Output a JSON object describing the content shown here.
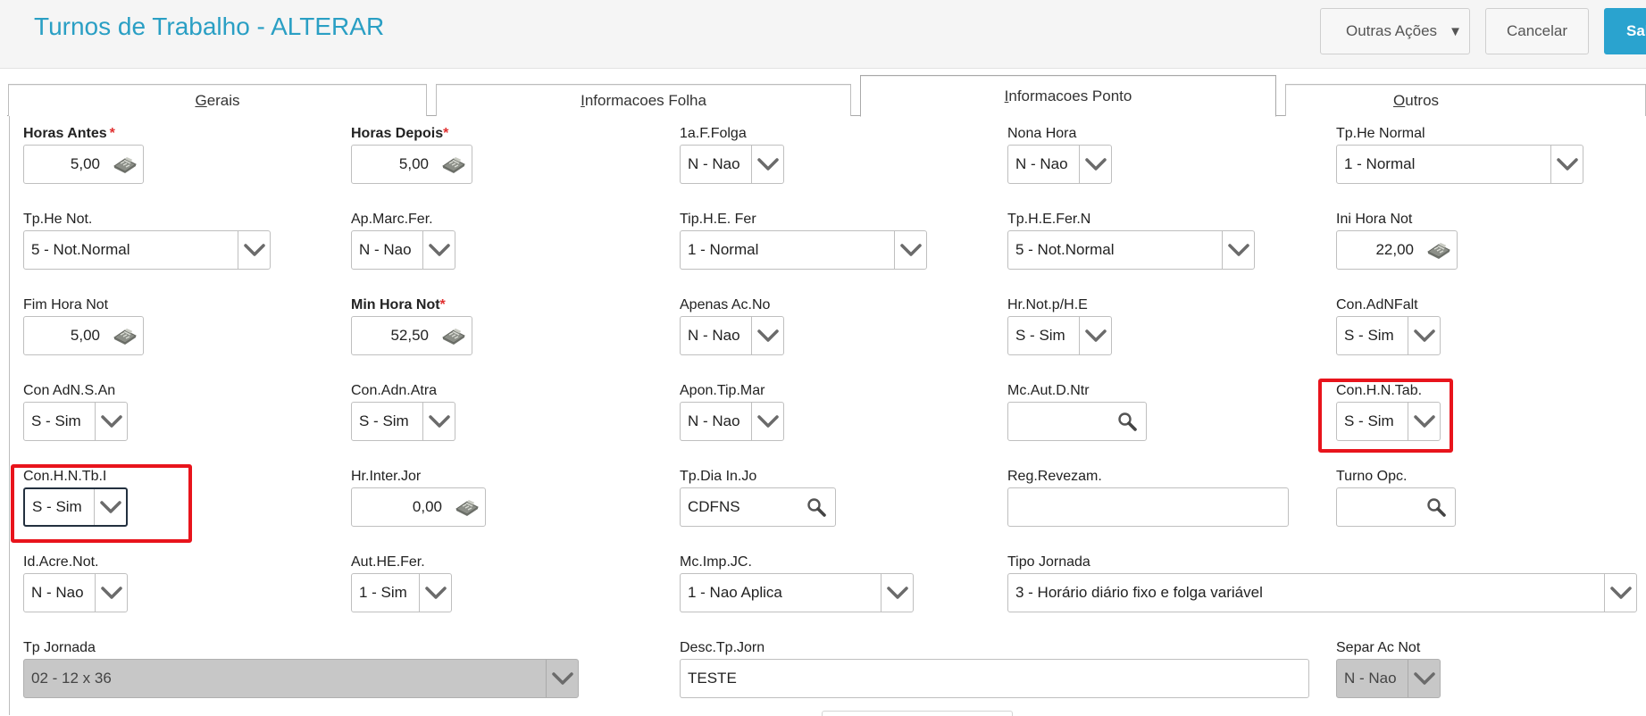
{
  "header": {
    "title": "Turnos de Trabalho - ALTERAR",
    "more_actions": "Outras Ações",
    "cancel": "Cancelar",
    "save": "Sal"
  },
  "tabs": [
    {
      "label": "Gerais",
      "accel": "G",
      "rest": "erais"
    },
    {
      "label": "Informacoes Folha",
      "accel": "I",
      "rest": "nformacoes Folha"
    },
    {
      "label": "Informacoes Ponto",
      "accel": "I",
      "rest": "nformacoes Ponto"
    },
    {
      "label": "Outros",
      "accel": "O",
      "rest": "utros"
    }
  ],
  "fields": {
    "horas_antes": {
      "label": "Horas Antes",
      "value": "5,00"
    },
    "horas_depois": {
      "label": "Horas Depois",
      "value": "5,00"
    },
    "primeira_folga": {
      "label": "1a.F.Folga",
      "value": "N - Nao"
    },
    "nona_hora": {
      "label": "Nona Hora",
      "value": "N - Nao"
    },
    "tp_he_normal": {
      "label": "Tp.He Normal",
      "value": "1 - Normal"
    },
    "tp_he_not": {
      "label": "Tp.He Not.",
      "value": "5 - Not.Normal"
    },
    "ap_marc_fer": {
      "label": "Ap.Marc.Fer.",
      "value": "N - Nao"
    },
    "tip_he_fer": {
      "label": "Tip.H.E. Fer",
      "value": "1 - Normal"
    },
    "tp_he_fer_n": {
      "label": "Tp.H.E.Fer.N",
      "value": "5 - Not.Normal"
    },
    "ini_hora_not": {
      "label": "Ini Hora Not",
      "value": "22,00"
    },
    "fim_hora_not": {
      "label": "Fim Hora Not",
      "value": "5,00"
    },
    "min_hora_not": {
      "label": "Min Hora Not",
      "value": "52,50"
    },
    "apenas_ac_no": {
      "label": "Apenas Ac.No",
      "value": "N - Nao"
    },
    "hr_not_p_he": {
      "label": "Hr.Not.p/H.E",
      "value": "S - Sim"
    },
    "con_adnfalt": {
      "label": "Con.AdNFalt",
      "value": "S - Sim"
    },
    "con_adn_s_an": {
      "label": "Con AdN.S.An",
      "value": "S - Sim"
    },
    "con_adn_atra": {
      "label": "Con.Adn.Atra",
      "value": "S - Sim"
    },
    "apon_tip_mar": {
      "label": "Apon.Tip.Mar",
      "value": "N - Nao"
    },
    "mc_aut_d_ntr": {
      "label": "Mc.Aut.D.Ntr",
      "value": ""
    },
    "con_hn_tab": {
      "label": "Con.H.N.Tab.",
      "value": "S - Sim"
    },
    "con_hn_tb_i": {
      "label": "Con.H.N.Tb.I",
      "value": "S - Sim"
    },
    "hr_inter_jor": {
      "label": "Hr.Inter.Jor",
      "value": "0,00"
    },
    "tp_dia_in_jo": {
      "label": "Tp.Dia In.Jo",
      "value": "CDFNS"
    },
    "reg_revezam": {
      "label": "Reg.Revezam.",
      "value": ""
    },
    "turno_opc": {
      "label": "Turno Opc.",
      "value": ""
    },
    "id_acre_not": {
      "label": "Id.Acre.Not.",
      "value": "N - Nao"
    },
    "aut_he_fer": {
      "label": "Aut.HE.Fer.",
      "value": "1 - Sim"
    },
    "mc_imp_jc": {
      "label": "Mc.Imp.JC.",
      "value": "1 - Nao Aplica"
    },
    "tipo_jornada": {
      "label": "Tipo Jornada",
      "value": "3 - Horário diário fixo e folga variável"
    },
    "tp_jornada": {
      "label": "Tp Jornada",
      "value": "02 - 12 x 36"
    },
    "desc_tp_jorn": {
      "label": "Desc.Tp.Jorn",
      "value": "TESTE"
    },
    "separ_ac_not": {
      "label": "Separ Ac Not",
      "value": "N - Nao"
    }
  },
  "colors": {
    "accent": "#2a9fc4",
    "save_button": "#2aa3cf",
    "highlight": "#e8141c",
    "required": "#e03030"
  },
  "icons": {
    "calculator": "calculator-icon",
    "dropdown": "chevron-down-icon",
    "lookup": "search-icon",
    "caret": "caret-down-icon"
  }
}
